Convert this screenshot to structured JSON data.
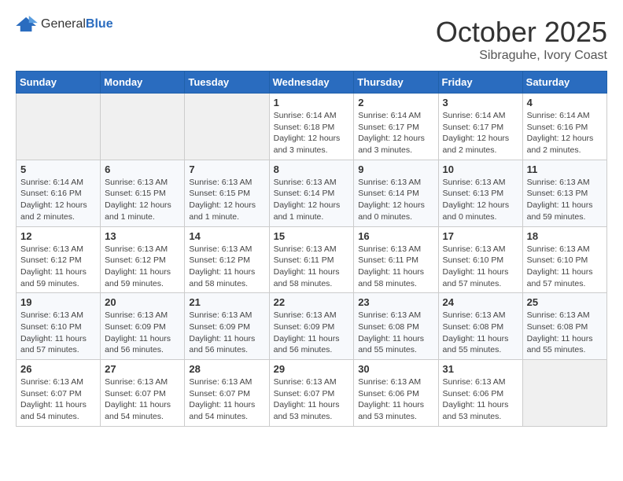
{
  "header": {
    "logo": {
      "general": "General",
      "blue": "Blue"
    },
    "title": "October 2025",
    "subtitle": "Sibraguhe, Ivory Coast"
  },
  "days_of_week": [
    "Sunday",
    "Monday",
    "Tuesday",
    "Wednesday",
    "Thursday",
    "Friday",
    "Saturday"
  ],
  "weeks": [
    [
      {
        "day": "",
        "info": ""
      },
      {
        "day": "",
        "info": ""
      },
      {
        "day": "",
        "info": ""
      },
      {
        "day": "1",
        "info": "Sunrise: 6:14 AM\nSunset: 6:18 PM\nDaylight: 12 hours\nand 3 minutes."
      },
      {
        "day": "2",
        "info": "Sunrise: 6:14 AM\nSunset: 6:17 PM\nDaylight: 12 hours\nand 3 minutes."
      },
      {
        "day": "3",
        "info": "Sunrise: 6:14 AM\nSunset: 6:17 PM\nDaylight: 12 hours\nand 2 minutes."
      },
      {
        "day": "4",
        "info": "Sunrise: 6:14 AM\nSunset: 6:16 PM\nDaylight: 12 hours\nand 2 minutes."
      }
    ],
    [
      {
        "day": "5",
        "info": "Sunrise: 6:14 AM\nSunset: 6:16 PM\nDaylight: 12 hours\nand 2 minutes."
      },
      {
        "day": "6",
        "info": "Sunrise: 6:13 AM\nSunset: 6:15 PM\nDaylight: 12 hours\nand 1 minute."
      },
      {
        "day": "7",
        "info": "Sunrise: 6:13 AM\nSunset: 6:15 PM\nDaylight: 12 hours\nand 1 minute."
      },
      {
        "day": "8",
        "info": "Sunrise: 6:13 AM\nSunset: 6:14 PM\nDaylight: 12 hours\nand 1 minute."
      },
      {
        "day": "9",
        "info": "Sunrise: 6:13 AM\nSunset: 6:14 PM\nDaylight: 12 hours\nand 0 minutes."
      },
      {
        "day": "10",
        "info": "Sunrise: 6:13 AM\nSunset: 6:13 PM\nDaylight: 12 hours\nand 0 minutes."
      },
      {
        "day": "11",
        "info": "Sunrise: 6:13 AM\nSunset: 6:13 PM\nDaylight: 11 hours\nand 59 minutes."
      }
    ],
    [
      {
        "day": "12",
        "info": "Sunrise: 6:13 AM\nSunset: 6:12 PM\nDaylight: 11 hours\nand 59 minutes."
      },
      {
        "day": "13",
        "info": "Sunrise: 6:13 AM\nSunset: 6:12 PM\nDaylight: 11 hours\nand 59 minutes."
      },
      {
        "day": "14",
        "info": "Sunrise: 6:13 AM\nSunset: 6:12 PM\nDaylight: 11 hours\nand 58 minutes."
      },
      {
        "day": "15",
        "info": "Sunrise: 6:13 AM\nSunset: 6:11 PM\nDaylight: 11 hours\nand 58 minutes."
      },
      {
        "day": "16",
        "info": "Sunrise: 6:13 AM\nSunset: 6:11 PM\nDaylight: 11 hours\nand 58 minutes."
      },
      {
        "day": "17",
        "info": "Sunrise: 6:13 AM\nSunset: 6:10 PM\nDaylight: 11 hours\nand 57 minutes."
      },
      {
        "day": "18",
        "info": "Sunrise: 6:13 AM\nSunset: 6:10 PM\nDaylight: 11 hours\nand 57 minutes."
      }
    ],
    [
      {
        "day": "19",
        "info": "Sunrise: 6:13 AM\nSunset: 6:10 PM\nDaylight: 11 hours\nand 57 minutes."
      },
      {
        "day": "20",
        "info": "Sunrise: 6:13 AM\nSunset: 6:09 PM\nDaylight: 11 hours\nand 56 minutes."
      },
      {
        "day": "21",
        "info": "Sunrise: 6:13 AM\nSunset: 6:09 PM\nDaylight: 11 hours\nand 56 minutes."
      },
      {
        "day": "22",
        "info": "Sunrise: 6:13 AM\nSunset: 6:09 PM\nDaylight: 11 hours\nand 56 minutes."
      },
      {
        "day": "23",
        "info": "Sunrise: 6:13 AM\nSunset: 6:08 PM\nDaylight: 11 hours\nand 55 minutes."
      },
      {
        "day": "24",
        "info": "Sunrise: 6:13 AM\nSunset: 6:08 PM\nDaylight: 11 hours\nand 55 minutes."
      },
      {
        "day": "25",
        "info": "Sunrise: 6:13 AM\nSunset: 6:08 PM\nDaylight: 11 hours\nand 55 minutes."
      }
    ],
    [
      {
        "day": "26",
        "info": "Sunrise: 6:13 AM\nSunset: 6:07 PM\nDaylight: 11 hours\nand 54 minutes."
      },
      {
        "day": "27",
        "info": "Sunrise: 6:13 AM\nSunset: 6:07 PM\nDaylight: 11 hours\nand 54 minutes."
      },
      {
        "day": "28",
        "info": "Sunrise: 6:13 AM\nSunset: 6:07 PM\nDaylight: 11 hours\nand 54 minutes."
      },
      {
        "day": "29",
        "info": "Sunrise: 6:13 AM\nSunset: 6:07 PM\nDaylight: 11 hours\nand 53 minutes."
      },
      {
        "day": "30",
        "info": "Sunrise: 6:13 AM\nSunset: 6:06 PM\nDaylight: 11 hours\nand 53 minutes."
      },
      {
        "day": "31",
        "info": "Sunrise: 6:13 AM\nSunset: 6:06 PM\nDaylight: 11 hours\nand 53 minutes."
      },
      {
        "day": "",
        "info": ""
      }
    ]
  ]
}
